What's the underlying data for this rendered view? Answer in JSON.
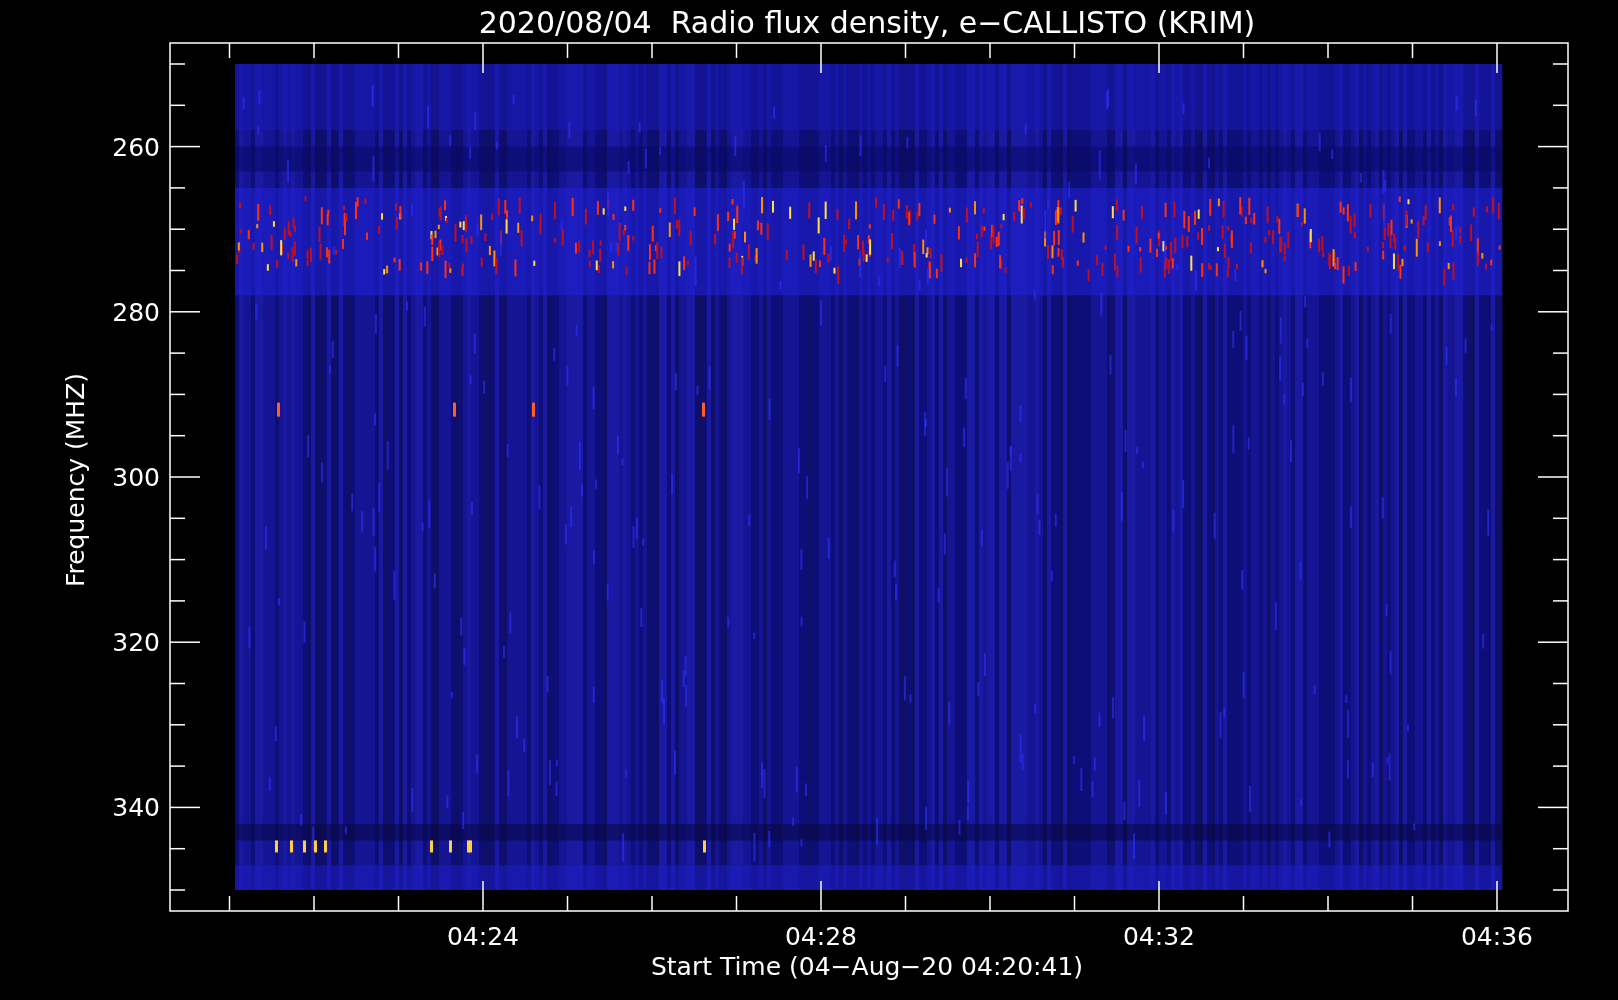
{
  "title": "2020/08/04  Radio flux density, e−CALLISTO (KRIM)",
  "y_axis": {
    "label": "Frequency (MHZ)",
    "ticks": [
      "260",
      "280",
      "300",
      "320",
      "340"
    ]
  },
  "x_axis": {
    "label": "Start Time (04−Aug−20 04:20:41)",
    "ticks": [
      "04:24",
      "04:28",
      "04:32",
      "04:36"
    ]
  }
}
